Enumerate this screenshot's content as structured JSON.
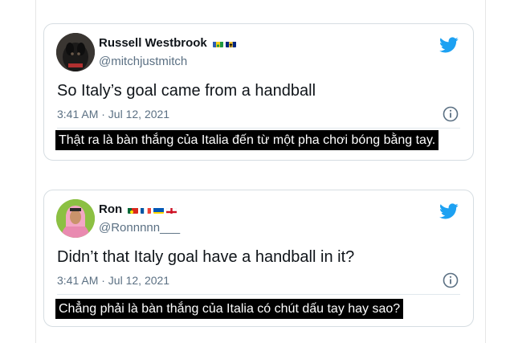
{
  "tweets": [
    {
      "display_name": "Russell Westbrook",
      "handle": "@mitchjustmitch",
      "text": "So Italy’s goal came from a handball",
      "timestamp": "3:41 AM · Jul 12, 2021",
      "caption": "Thật ra là bàn thắng của Italia đến từ một pha chơi bóng bằng tay.",
      "flags": [
        "saint-vincent-flag",
        "barbados-flag"
      ]
    },
    {
      "display_name": "Ron",
      "handle": "@Ronnnnn___",
      "text": "Didn’t that Italy goal have a handball in it?",
      "timestamp": "3:41 AM · Jul 12, 2021",
      "caption": "Chẳng phải là bàn thắng của Italia có chút dấu tay hay sao?",
      "flags": [
        "portugal-flag",
        "france-flag",
        "ukraine-flag",
        "england-flag"
      ]
    }
  ],
  "colors": {
    "twitter_blue": "#1da1f2",
    "secondary_text": "#5b7083",
    "caption_bg": "#000000"
  }
}
